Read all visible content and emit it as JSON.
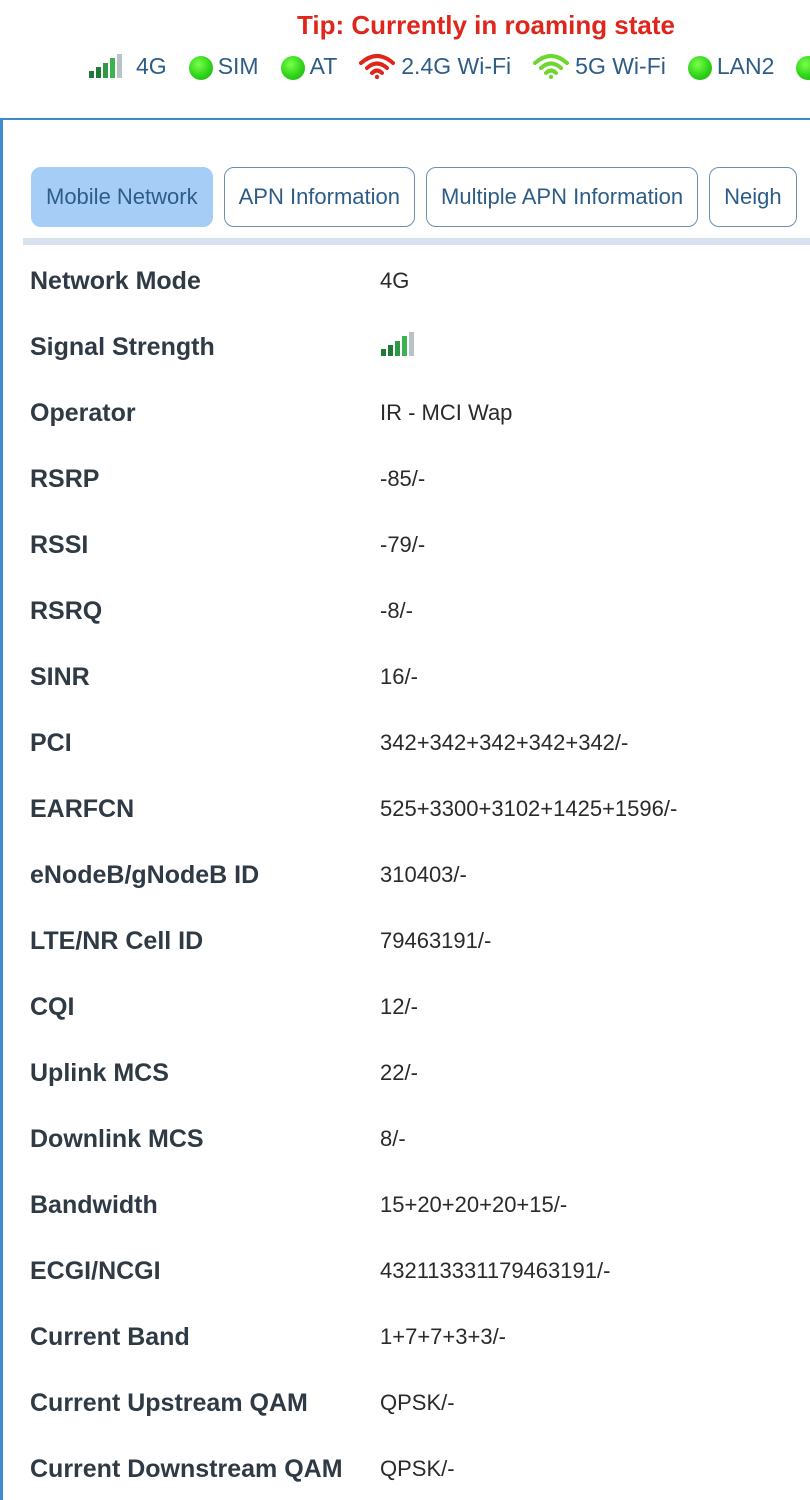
{
  "header": {
    "tip": "Tip: Currently in roaming state",
    "status_items": [
      {
        "icon": "signal-bars-icon",
        "label": "4G"
      },
      {
        "icon": "green-dot-icon",
        "label": "SIM"
      },
      {
        "icon": "green-dot-icon",
        "label": "AT"
      },
      {
        "icon": "wifi-icon",
        "label": "2.4G Wi-Fi",
        "color": "#e0251b"
      },
      {
        "icon": "wifi-icon",
        "label": "5G Wi-Fi",
        "color": "#6fd62f"
      },
      {
        "icon": "green-dot-icon",
        "label": "LAN2"
      }
    ]
  },
  "colors": {
    "accent": "#3e8bd1",
    "tip_red": "#e0251b",
    "status_green": "#2ed41a",
    "tab_active_bg": "#a6cdf5",
    "text_blue": "#2d5d87"
  },
  "tabs": [
    {
      "label": "Mobile Network",
      "active": true
    },
    {
      "label": "APN Information",
      "active": false
    },
    {
      "label": "Multiple APN Information",
      "active": false
    },
    {
      "label": "Neigh",
      "active": false
    }
  ],
  "info_rows": [
    {
      "label": "Network Mode",
      "value": "4G"
    },
    {
      "label": "Signal Strength",
      "value": "",
      "icon": "signal-bars-icon"
    },
    {
      "label": "Operator",
      "value": "IR - MCI Wap"
    },
    {
      "label": "RSRP",
      "value": "-85/-"
    },
    {
      "label": "RSSI",
      "value": "-79/-"
    },
    {
      "label": "RSRQ",
      "value": "-8/-"
    },
    {
      "label": "SINR",
      "value": "16/-"
    },
    {
      "label": "PCI",
      "value": "342+342+342+342+342/-"
    },
    {
      "label": "EARFCN",
      "value": "525+3300+3102+1425+1596/-"
    },
    {
      "label": "eNodeB/gNodeB ID",
      "value": "310403/-"
    },
    {
      "label": "LTE/NR Cell ID",
      "value": "79463191/-"
    },
    {
      "label": "CQI",
      "value": "12/-"
    },
    {
      "label": "Uplink MCS",
      "value": "22/-"
    },
    {
      "label": "Downlink MCS",
      "value": "8/-"
    },
    {
      "label": "Bandwidth",
      "value": "15+20+20+20+15/-"
    },
    {
      "label": "ECGI/NCGI",
      "value": "432113331179463191/-"
    },
    {
      "label": "Current Band",
      "value": "1+7+7+3+3/-"
    },
    {
      "label": "Current Upstream QAM",
      "value": "QPSK/-"
    },
    {
      "label": "Current Downstream QAM",
      "value": "QPSK/-"
    }
  ]
}
